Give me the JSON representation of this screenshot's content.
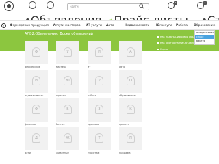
{
  "header": {
    "search_placeholder": "найти",
    "badges": [
      "6",
      "2"
    ]
  },
  "sub_nav": {
    "items": [
      "Объявления",
      "Прайс-листы"
    ],
    "right_label": "Ст"
  },
  "categories": [
    {
      "initial": "Ф",
      "rest": "ермерская продукция"
    },
    {
      "initial": "У",
      "rest": "слуги мастеров"
    },
    {
      "initial": "И",
      "rest": "Т услуги"
    },
    {
      "initial": "А",
      "rest": "вто"
    },
    {
      "initial": "Н",
      "rest": "едвижимость"
    },
    {
      "initial": "Ю",
      "rest": "ruслуги"
    },
    {
      "initial": "Р",
      "rest": "абота"
    },
    {
      "initial": "О",
      "rest": "бразование"
    }
  ],
  "dropdown": {
    "options": [
      "предложения",
      "спрос",
      "бартер"
    ],
    "selected_index": 1
  },
  "section_title": "АЛБ2.Объявления: Доска объявлений",
  "side_links": [
    "Как подать Цифровой объявления",
    "Как быстро найти Объявления",
    "Карта"
  ],
  "tiles": [
    {
      "letter": "Ф",
      "label": "фермерские"
    },
    {
      "letter": "У",
      "label": "мастера"
    },
    {
      "letter": "И",
      "label": "ит"
    },
    {
      "letter": "А",
      "label": "авто"
    },
    {
      "letter": "Н",
      "label": "недвижимость"
    },
    {
      "letter": "Ю",
      "label": "юристы"
    },
    {
      "letter": "Р",
      "label": "работа"
    },
    {
      "letter": "О",
      "label": "образование"
    },
    {
      "letter": "Ф",
      "label": "финансы"
    },
    {
      "letter": "Б",
      "label": "бизнес"
    },
    {
      "letter": "З",
      "label": "здоровье"
    },
    {
      "letter": "К",
      "label": "красота"
    },
    {
      "letter": "Д",
      "label": "дети"
    },
    {
      "letter": "Ж",
      "label": "животные"
    },
    {
      "letter": "Т",
      "label": "туристам"
    },
    {
      "letter": "П",
      "label": "продажа"
    }
  ]
}
